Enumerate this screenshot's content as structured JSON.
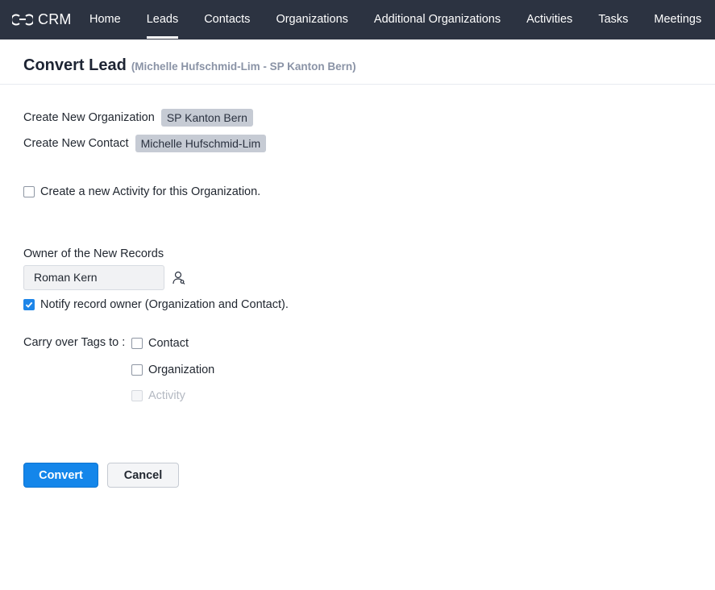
{
  "app": {
    "name": "CRM"
  },
  "nav": {
    "items": [
      {
        "label": "Home"
      },
      {
        "label": "Leads",
        "active": true
      },
      {
        "label": "Contacts"
      },
      {
        "label": "Organizations"
      },
      {
        "label": "Additional Organizations"
      },
      {
        "label": "Activities"
      },
      {
        "label": "Tasks"
      },
      {
        "label": "Meetings"
      }
    ]
  },
  "page": {
    "title": "Convert Lead",
    "subtitle": "(Michelle Hufschmid-Lim - SP Kanton Bern)"
  },
  "create_org": {
    "label": "Create New Organization",
    "value": "SP Kanton Bern"
  },
  "create_contact": {
    "label": "Create New Contact",
    "value": "Michelle Hufschmid-Lim"
  },
  "activity_option": {
    "label": "Create a new Activity for this Organization.",
    "checked": false
  },
  "owner": {
    "label": "Owner of the New Records",
    "value": "Roman Kern"
  },
  "notify": {
    "label": "Notify record owner (Organization and Contact).",
    "checked": true
  },
  "tags": {
    "label": "Carry over Tags to :",
    "options": [
      {
        "label": "Contact",
        "checked": false,
        "disabled": false
      },
      {
        "label": "Organization",
        "checked": false,
        "disabled": false
      },
      {
        "label": "Activity",
        "checked": false,
        "disabled": true
      }
    ]
  },
  "actions": {
    "convert_label": "Convert",
    "cancel_label": "Cancel"
  },
  "colors": {
    "topbar": "#2c3341",
    "primary": "#1486ea",
    "chip": "#c6cbd4"
  },
  "icons": {
    "logo": "crm-logo-icon",
    "owner_lookup": "user-lookup-icon",
    "check": "check-icon"
  }
}
